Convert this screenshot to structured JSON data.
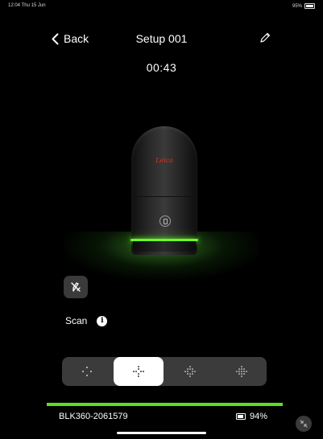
{
  "status_bar": {
    "time_date": "12:04  Thu 15 Jun",
    "battery": "95%"
  },
  "nav": {
    "back_label": "Back",
    "title": "Setup 001",
    "edit_icon": "pencil-icon"
  },
  "timer": "00:43",
  "device": {
    "brand_logo": "Leica",
    "ring_color": "#6bff2a"
  },
  "scan": {
    "label": "Scan",
    "info_icon": "info-icon",
    "tool_icon": "pen-tool-icon"
  },
  "density": {
    "options": [
      "sparse",
      "standard",
      "dense",
      "very-dense"
    ],
    "selected": "standard"
  },
  "progress": {
    "value": 1.0,
    "color": "#58e21f"
  },
  "footer": {
    "device_name": "BLK360-2061579",
    "battery": "94%"
  }
}
